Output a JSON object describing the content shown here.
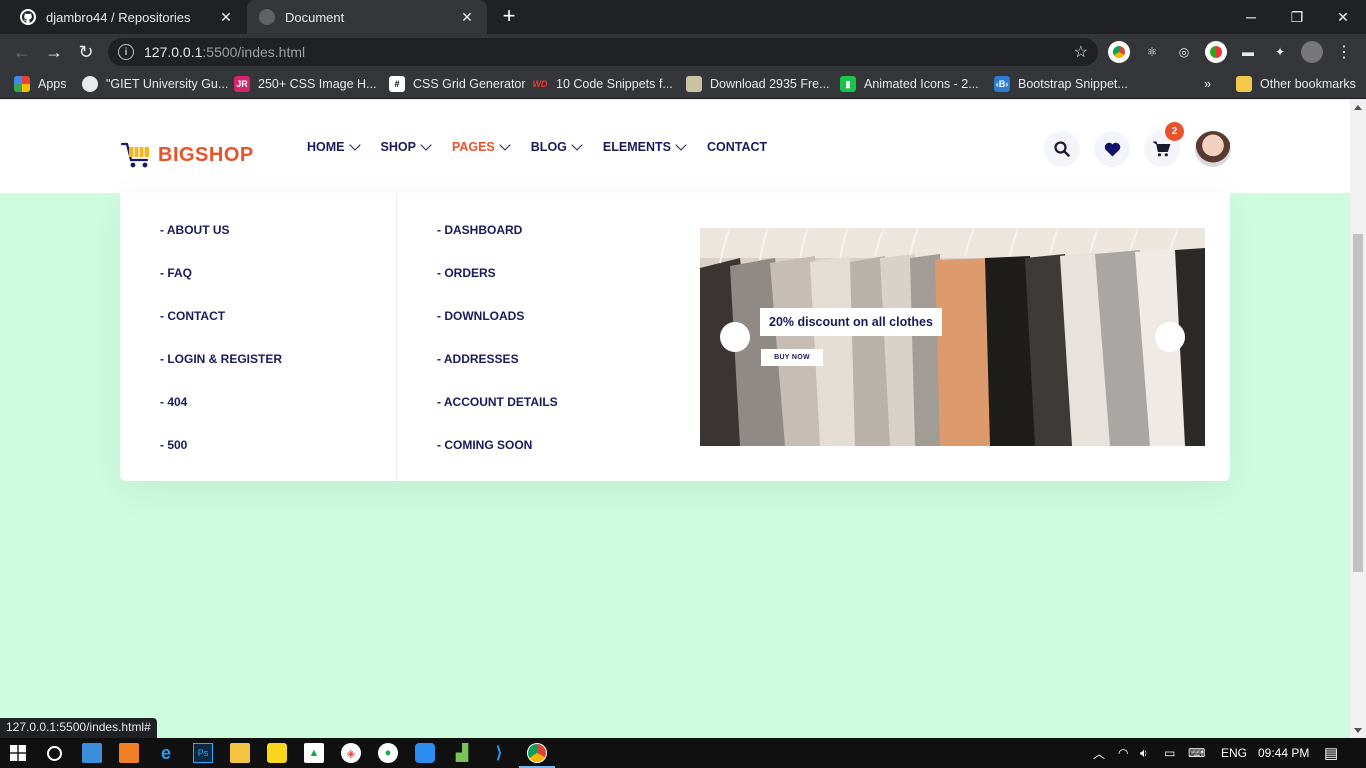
{
  "browser": {
    "tabs": [
      {
        "title": "djambro44 / Repositories",
        "active": false
      },
      {
        "title": "Document",
        "active": true
      }
    ],
    "url_host": "127.0.0.1",
    "url_rest": ":5500/indes.html",
    "bookmarks": [
      {
        "label": "Apps",
        "icon": "apps-grid-icon"
      },
      {
        "label": "\"GIET University Gu...",
        "icon": "globe-icon"
      },
      {
        "label": "250+ CSS Image H...",
        "icon": "jr-icon"
      },
      {
        "label": "CSS Grid Generator",
        "icon": "grid-icon"
      },
      {
        "label": "10 Code Snippets f...",
        "icon": "wd-icon"
      },
      {
        "label": "Download 2935 Fre...",
        "icon": "image-icon"
      },
      {
        "label": "Animated Icons - 2...",
        "icon": "animated-icon"
      },
      {
        "label": "Bootstrap Snippet...",
        "icon": "bootstrap-icon"
      }
    ],
    "more_bookmarks": "»",
    "other_bookmarks": "Other bookmarks",
    "status_url": "127.0.0.1:5500/indes.html#"
  },
  "site": {
    "brand": "BIGSHOP",
    "nav": [
      {
        "label": "HOME",
        "dropdown": true,
        "active": false
      },
      {
        "label": "SHOP",
        "dropdown": true,
        "active": false
      },
      {
        "label": "PAGES",
        "dropdown": true,
        "active": true
      },
      {
        "label": "BLOG",
        "dropdown": true,
        "active": false
      },
      {
        "label": "ELEMENTS",
        "dropdown": true,
        "active": false
      },
      {
        "label": "CONTACT",
        "dropdown": false,
        "active": false
      }
    ],
    "cart_count": "2",
    "accent_color": "#e8532b",
    "text_color": "#1a1a5c",
    "page_bg": "#cdfcdf"
  },
  "mega_menu": {
    "column1": [
      "- ABOUT US",
      "- FAQ",
      "- CONTACT",
      "- LOGIN & REGISTER",
      "- 404",
      "- 500"
    ],
    "column2": [
      "- DASHBOARD",
      "- ORDERS",
      "- DOWNLOADS",
      "- ADDRESSES",
      "- ACCOUNT DETAILS",
      "- COMING SOON"
    ],
    "promo": {
      "headline": "20% discount on all clothes",
      "button": "BUY NOW"
    }
  },
  "taskbar": {
    "language": "ENG",
    "time": "09:44 PM"
  }
}
